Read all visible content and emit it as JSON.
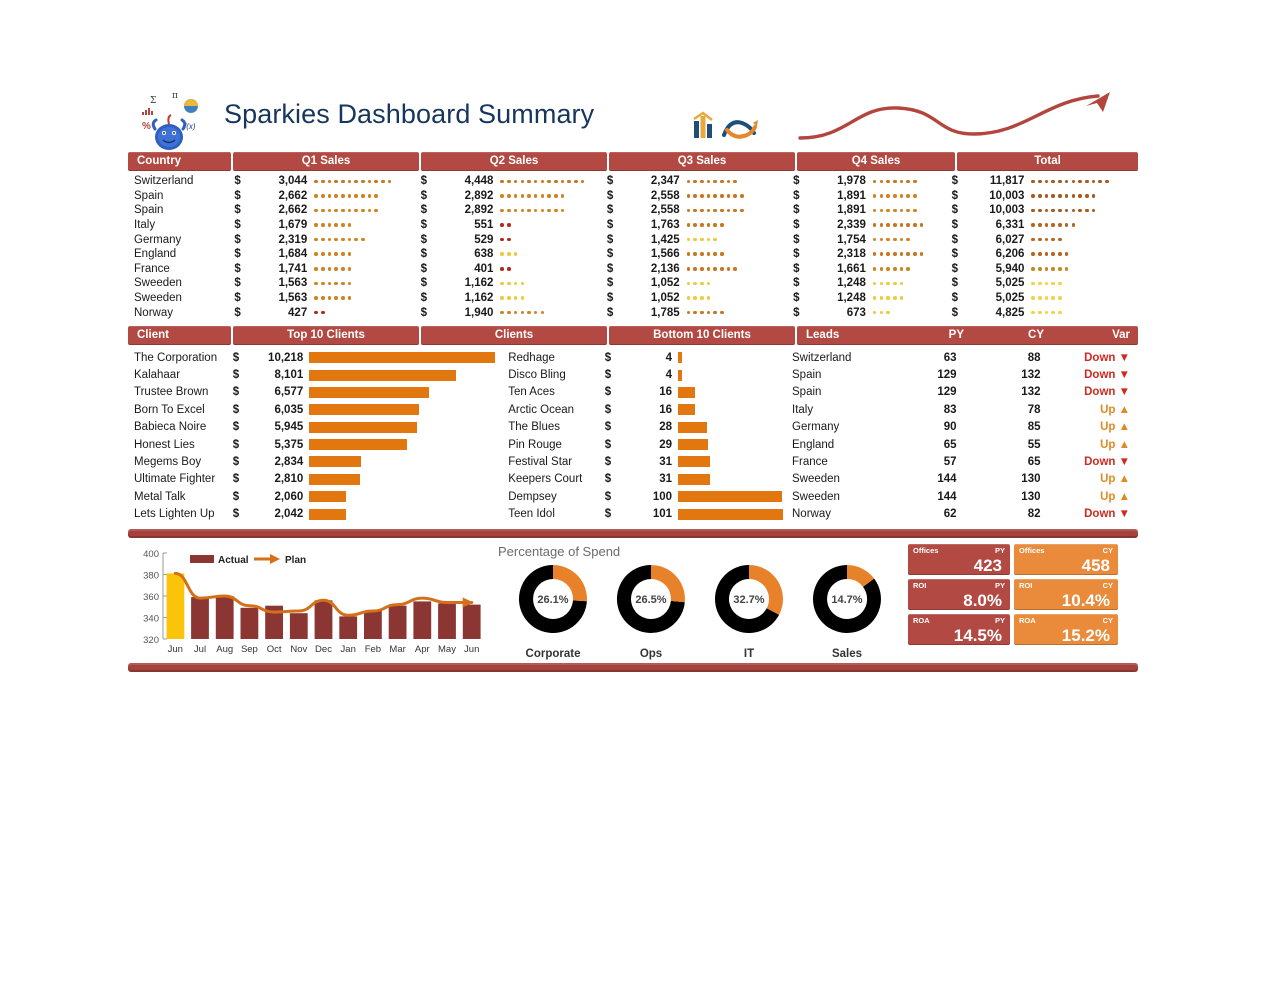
{
  "header": {
    "title": "Sparkies Dashboard Summary",
    "logo_icon": "sparky-mascot-logo",
    "icons": [
      "bar-chart-icon",
      "trend-swoosh-icon"
    ],
    "wave_icon": "rising-wave-arrow"
  },
  "sales_table": {
    "headers": [
      "Country",
      "Q1 Sales",
      "Q2 Sales",
      "Q3 Sales",
      "Q4 Sales",
      "Total"
    ],
    "currency": "$",
    "rows": [
      {
        "country": "Switzerland",
        "q1": "3,044",
        "q1n": 12,
        "q1c": "#c8761f",
        "q2": "4,448",
        "q2n": 13,
        "q2c": "#c8761f",
        "q3": "2,347",
        "q3n": 8,
        "q3c": "#c8761f",
        "q4": "1,978",
        "q4n": 7,
        "q4c": "#c8761f",
        "total": "11,817",
        "tn": 12,
        "tc": "#a65a1e"
      },
      {
        "country": "Spain",
        "q1": "2,662",
        "q1n": 10,
        "q1c": "#cf8420",
        "q2": "2,892",
        "q2n": 10,
        "q2c": "#cf8420",
        "q3": "2,558",
        "q3n": 9,
        "q3c": "#c8761f",
        "q4": "1,891",
        "q4n": 7,
        "q4c": "#cf8420",
        "total": "10,003",
        "tn": 10,
        "tc": "#a65a1e"
      },
      {
        "country": "Spain",
        "q1": "2,662",
        "q1n": 10,
        "q1c": "#cf8420",
        "q2": "2,892",
        "q2n": 10,
        "q2c": "#cf8420",
        "q3": "2,558",
        "q3n": 9,
        "q3c": "#c8761f",
        "q4": "1,891",
        "q4n": 7,
        "q4c": "#cf8420",
        "total": "10,003",
        "tn": 10,
        "tc": "#a65a1e"
      },
      {
        "country": "Italy",
        "q1": "1,679",
        "q1n": 6,
        "q1c": "#cf8420",
        "q2": "551",
        "q2n": 2,
        "q2c": "#b02a1e",
        "q3": "1,763",
        "q3n": 6,
        "q3c": "#c8761f",
        "q4": "2,339",
        "q4n": 8,
        "q4c": "#c8761f",
        "total": "6,331",
        "tn": 7,
        "tc": "#b4651f"
      },
      {
        "country": "Germany",
        "q1": "2,319",
        "q1n": 8,
        "q1c": "#cf8420",
        "q2": "529",
        "q2n": 2,
        "q2c": "#b02a1e",
        "q3": "1,425",
        "q3n": 5,
        "q3c": "#ecc93c",
        "q4": "1,754",
        "q4n": 6,
        "q4c": "#cf8420",
        "total": "6,027",
        "tn": 5,
        "tc": "#b4651f"
      },
      {
        "country": "England",
        "q1": "1,684",
        "q1n": 6,
        "q1c": "#cf8420",
        "q2": "638",
        "q2n": 3,
        "q2c": "#edcb3e",
        "q3": "1,566",
        "q3n": 6,
        "q3c": "#c8761f",
        "q4": "2,318",
        "q4n": 8,
        "q4c": "#c8761f",
        "total": "6,206",
        "tn": 6,
        "tc": "#b4651f"
      },
      {
        "country": "France",
        "q1": "1,741",
        "q1n": 6,
        "q1c": "#cf8420",
        "q2": "401",
        "q2n": 2,
        "q2c": "#b02a1e",
        "q3": "2,136",
        "q3n": 8,
        "q3c": "#c8761f",
        "q4": "1,661",
        "q4n": 6,
        "q4c": "#cf8420",
        "total": "5,940",
        "tn": 6,
        "tc": "#c08c22"
      },
      {
        "country": "Sweeden",
        "q1": "1,563",
        "q1n": 6,
        "q1c": "#cf8420",
        "q2": "1,162",
        "q2n": 4,
        "q2c": "#edcb3e",
        "q3": "1,052",
        "q3n": 4,
        "q3c": "#edcb3e",
        "q4": "1,248",
        "q4n": 5,
        "q4c": "#edcb3e",
        "total": "5,025",
        "tn": 5,
        "tc": "#eed544"
      },
      {
        "country": "Sweeden",
        "q1": "1,563",
        "q1n": 6,
        "q1c": "#cf8420",
        "q2": "1,162",
        "q2n": 4,
        "q2c": "#edcb3e",
        "q3": "1,052",
        "q3n": 4,
        "q3c": "#edcb3e",
        "q4": "1,248",
        "q4n": 5,
        "q4c": "#edcb3e",
        "total": "5,025",
        "tn": 5,
        "tc": "#eed544"
      },
      {
        "country": "Norway",
        "q1": "427",
        "q1n": 2,
        "q1c": "#b02a1e",
        "q2": "1,940",
        "q2n": 7,
        "q2c": "#cf8420",
        "q3": "1,785",
        "q3n": 6,
        "q3c": "#c8761f",
        "q4": "673",
        "q4n": 3,
        "q4c": "#edcb3e",
        "total": "4,825",
        "tn": 5,
        "tc": "#eed544"
      }
    ]
  },
  "clients_table": {
    "headers": [
      "Client",
      "Top 10 Clients",
      "Clients",
      "Bottom 10 Clients",
      "Leads",
      "PY",
      "CY",
      "Var"
    ],
    "currency": "$",
    "top_max": 10218,
    "bottom_max": 101,
    "rows": [
      {
        "client": "The Corporation",
        "top": "10,218",
        "topn": 10218,
        "client2": "Redhage",
        "bot": "4",
        "botn": 4,
        "lead": "Switzerland",
        "py": "63",
        "cy": "88",
        "var": "Down",
        "dir": "down"
      },
      {
        "client": "Kalahaar",
        "top": "8,101",
        "topn": 8101,
        "client2": "Disco Bling",
        "bot": "4",
        "botn": 4,
        "lead": "Spain",
        "py": "129",
        "cy": "132",
        "var": "Down",
        "dir": "down"
      },
      {
        "client": "Trustee Brown",
        "top": "6,577",
        "topn": 6577,
        "client2": "Ten Aces",
        "bot": "16",
        "botn": 16,
        "lead": "Spain",
        "py": "129",
        "cy": "132",
        "var": "Down",
        "dir": "down"
      },
      {
        "client": "Born To Excel",
        "top": "6,035",
        "topn": 6035,
        "client2": "Arctic Ocean",
        "bot": "16",
        "botn": 16,
        "lead": "Italy",
        "py": "83",
        "cy": "78",
        "var": "Up",
        "dir": "up"
      },
      {
        "client": "Babieca Noire",
        "top": "5,945",
        "topn": 5945,
        "client2": "The Blues",
        "bot": "28",
        "botn": 28,
        "lead": "Germany",
        "py": "90",
        "cy": "85",
        "var": "Up",
        "dir": "up"
      },
      {
        "client": "Honest Lies",
        "top": "5,375",
        "topn": 5375,
        "client2": "Pin Rouge",
        "bot": "29",
        "botn": 29,
        "lead": "England",
        "py": "65",
        "cy": "55",
        "var": "Up",
        "dir": "up"
      },
      {
        "client": "Megems Boy",
        "top": "2,834",
        "topn": 2834,
        "client2": "Festival Star",
        "bot": "31",
        "botn": 31,
        "lead": "France",
        "py": "57",
        "cy": "65",
        "var": "Down",
        "dir": "down"
      },
      {
        "client": "Ultimate Fighter",
        "top": "2,810",
        "topn": 2810,
        "client2": "Keepers Court",
        "bot": "31",
        "botn": 31,
        "lead": "Sweeden",
        "py": "144",
        "cy": "130",
        "var": "Up",
        "dir": "up"
      },
      {
        "client": "Metal Talk",
        "top": "2,060",
        "topn": 2060,
        "client2": "Dempsey",
        "bot": "100",
        "botn": 100,
        "lead": "Sweeden",
        "py": "144",
        "cy": "130",
        "var": "Up",
        "dir": "up"
      },
      {
        "client": "Lets Lighten Up",
        "top": "2,042",
        "topn": 2042,
        "client2": "Teen Idol",
        "bot": "101",
        "botn": 101,
        "lead": "Norway",
        "py": "62",
        "cy": "82",
        "var": "Down",
        "dir": "down"
      }
    ]
  },
  "chart_data": [
    {
      "type": "bar",
      "title": "",
      "xlabel": "",
      "ylabel": "",
      "ylim": [
        320,
        400
      ],
      "yticks": [
        320,
        340,
        360,
        380,
        400
      ],
      "grid": false,
      "legend": [
        "Actual",
        "Plan"
      ],
      "legend_position": "top-left",
      "categories": [
        "Jun",
        "Jul",
        "Aug",
        "Sep",
        "Oct",
        "Nov",
        "Dec",
        "Jan",
        "Feb",
        "Mar",
        "Apr",
        "May",
        "Jun"
      ],
      "series": [
        {
          "name": "Actual",
          "values": [
            381,
            359,
            360,
            349,
            351,
            344,
            356,
            341,
            346,
            351,
            355,
            353,
            352
          ]
        },
        {
          "name": "Plan",
          "values": [
            381,
            358,
            360,
            351,
            345,
            346,
            356,
            342,
            346,
            352,
            358,
            354,
            354
          ]
        }
      ],
      "highlight_index": 0
    },
    {
      "type": "pie",
      "title": "Percentage of Spend",
      "labels": [
        "Corporate",
        "Ops",
        "IT",
        "Sales"
      ],
      "values": [
        26.1,
        26.5,
        32.7,
        14.7
      ],
      "value_labels": [
        "26.1%",
        "26.5%",
        "32.7%",
        "14.7%"
      ]
    }
  ],
  "kpis": [
    {
      "label": "Offices",
      "period": "PY",
      "value": "423",
      "kind": "py"
    },
    {
      "label": "Offices",
      "period": "CY",
      "value": "458",
      "kind": "cy"
    },
    {
      "label": "ROI",
      "period": "PY",
      "value": "8.0%",
      "kind": "py"
    },
    {
      "label": "ROI",
      "period": "CY",
      "value": "10.4%",
      "kind": "cy"
    },
    {
      "label": "ROA",
      "period": "PY",
      "value": "14.5%",
      "kind": "py"
    },
    {
      "label": "ROA",
      "period": "CY",
      "value": "15.2%",
      "kind": "cy"
    }
  ],
  "colors": {
    "band": "#b24a43",
    "orange": "#e2760f",
    "dark_red": "#8c3633",
    "yellow": "#fcc30b",
    "plan_line": "#d4701a",
    "down": "#cf2a20",
    "up": "#e08a23"
  }
}
